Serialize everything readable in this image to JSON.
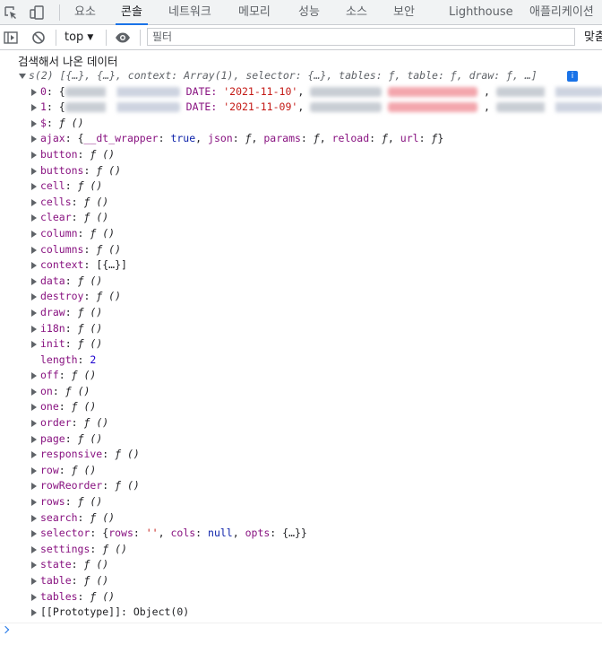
{
  "tabs": [
    {
      "label": "요소",
      "active": false
    },
    {
      "label": "콘솔",
      "active": true
    },
    {
      "label": "네트워크",
      "active": false
    },
    {
      "label": "메모리",
      "active": false
    },
    {
      "label": "성능",
      "active": false
    },
    {
      "label": "소스",
      "active": false
    },
    {
      "label": "보안",
      "active": false
    },
    {
      "label": "Lighthouse",
      "active": false
    },
    {
      "label": "애플리케이션",
      "active": false
    }
  ],
  "toolbar": {
    "context": "top",
    "filter_placeholder": "필터",
    "levels_label": "맞춤"
  },
  "console": {
    "message": "검색해서 나온 데이터",
    "summary": {
      "prefix": "s(2) [{…}, {…}, context: Array(1), selector: {…}, tables: ƒ, table: ƒ, draw: ƒ, …]",
      "info_icon": "i"
    },
    "rows": [
      {
        "key": "0",
        "date_label": "DATE:",
        "date": "'2021-11-10'"
      },
      {
        "key": "1",
        "date_label": "DATE:",
        "date": "'2021-11-09'"
      }
    ],
    "properties": [
      {
        "key": "$",
        "value": "ƒ ()",
        "expandable": true
      },
      {
        "key": "ajax",
        "value": "{__dt_wrapper: true, json: ƒ, params: ƒ, reload: ƒ, url: ƒ}",
        "expandable": true
      },
      {
        "key": "button",
        "value": "ƒ ()",
        "expandable": true
      },
      {
        "key": "buttons",
        "value": "ƒ ()",
        "expandable": true
      },
      {
        "key": "cell",
        "value": "ƒ ()",
        "expandable": true
      },
      {
        "key": "cells",
        "value": "ƒ ()",
        "expandable": true
      },
      {
        "key": "clear",
        "value": "ƒ ()",
        "expandable": true
      },
      {
        "key": "column",
        "value": "ƒ ()",
        "expandable": true
      },
      {
        "key": "columns",
        "value": "ƒ ()",
        "expandable": true
      },
      {
        "key": "context",
        "value": "[{…}]",
        "expandable": true
      },
      {
        "key": "data",
        "value": "ƒ ()",
        "expandable": true
      },
      {
        "key": "destroy",
        "value": "ƒ ()",
        "expandable": true
      },
      {
        "key": "draw",
        "value": "ƒ ()",
        "expandable": true
      },
      {
        "key": "i18n",
        "value": "ƒ ()",
        "expandable": true
      },
      {
        "key": "init",
        "value": "ƒ ()",
        "expandable": true
      },
      {
        "key": "length",
        "value": "2",
        "expandable": false
      },
      {
        "key": "off",
        "value": "ƒ ()",
        "expandable": true
      },
      {
        "key": "on",
        "value": "ƒ ()",
        "expandable": true
      },
      {
        "key": "one",
        "value": "ƒ ()",
        "expandable": true
      },
      {
        "key": "order",
        "value": "ƒ ()",
        "expandable": true
      },
      {
        "key": "page",
        "value": "ƒ ()",
        "expandable": true
      },
      {
        "key": "responsive",
        "value": "ƒ ()",
        "expandable": true
      },
      {
        "key": "row",
        "value": "ƒ ()",
        "expandable": true
      },
      {
        "key": "rowReorder",
        "value": "ƒ ()",
        "expandable": true
      },
      {
        "key": "rows",
        "value": "ƒ ()",
        "expandable": true
      },
      {
        "key": "search",
        "value": "ƒ ()",
        "expandable": true
      },
      {
        "key": "selector",
        "value": "{rows: '', cols: null, opts: {…}}",
        "expandable": true
      },
      {
        "key": "settings",
        "value": "ƒ ()",
        "expandable": true
      },
      {
        "key": "state",
        "value": "ƒ ()",
        "expandable": true
      },
      {
        "key": "table",
        "value": "ƒ ()",
        "expandable": true
      },
      {
        "key": "tables",
        "value": "ƒ ()",
        "expandable": true
      },
      {
        "key": "[[Prototype]]",
        "value": "Object(0)",
        "expandable": true,
        "internal": true
      }
    ]
  },
  "colors": {
    "accent": "#1a73e8",
    "key": "#881280",
    "string": "#c41a16",
    "number": "#1c00cf",
    "bool": "#0d22aa"
  },
  "icons": [
    "inspect-element-icon",
    "device-toolbar-icon",
    "sidebar-toggle-icon",
    "clear-console-icon",
    "eye-icon",
    "info-icon",
    "prompt-caret-icon"
  ]
}
